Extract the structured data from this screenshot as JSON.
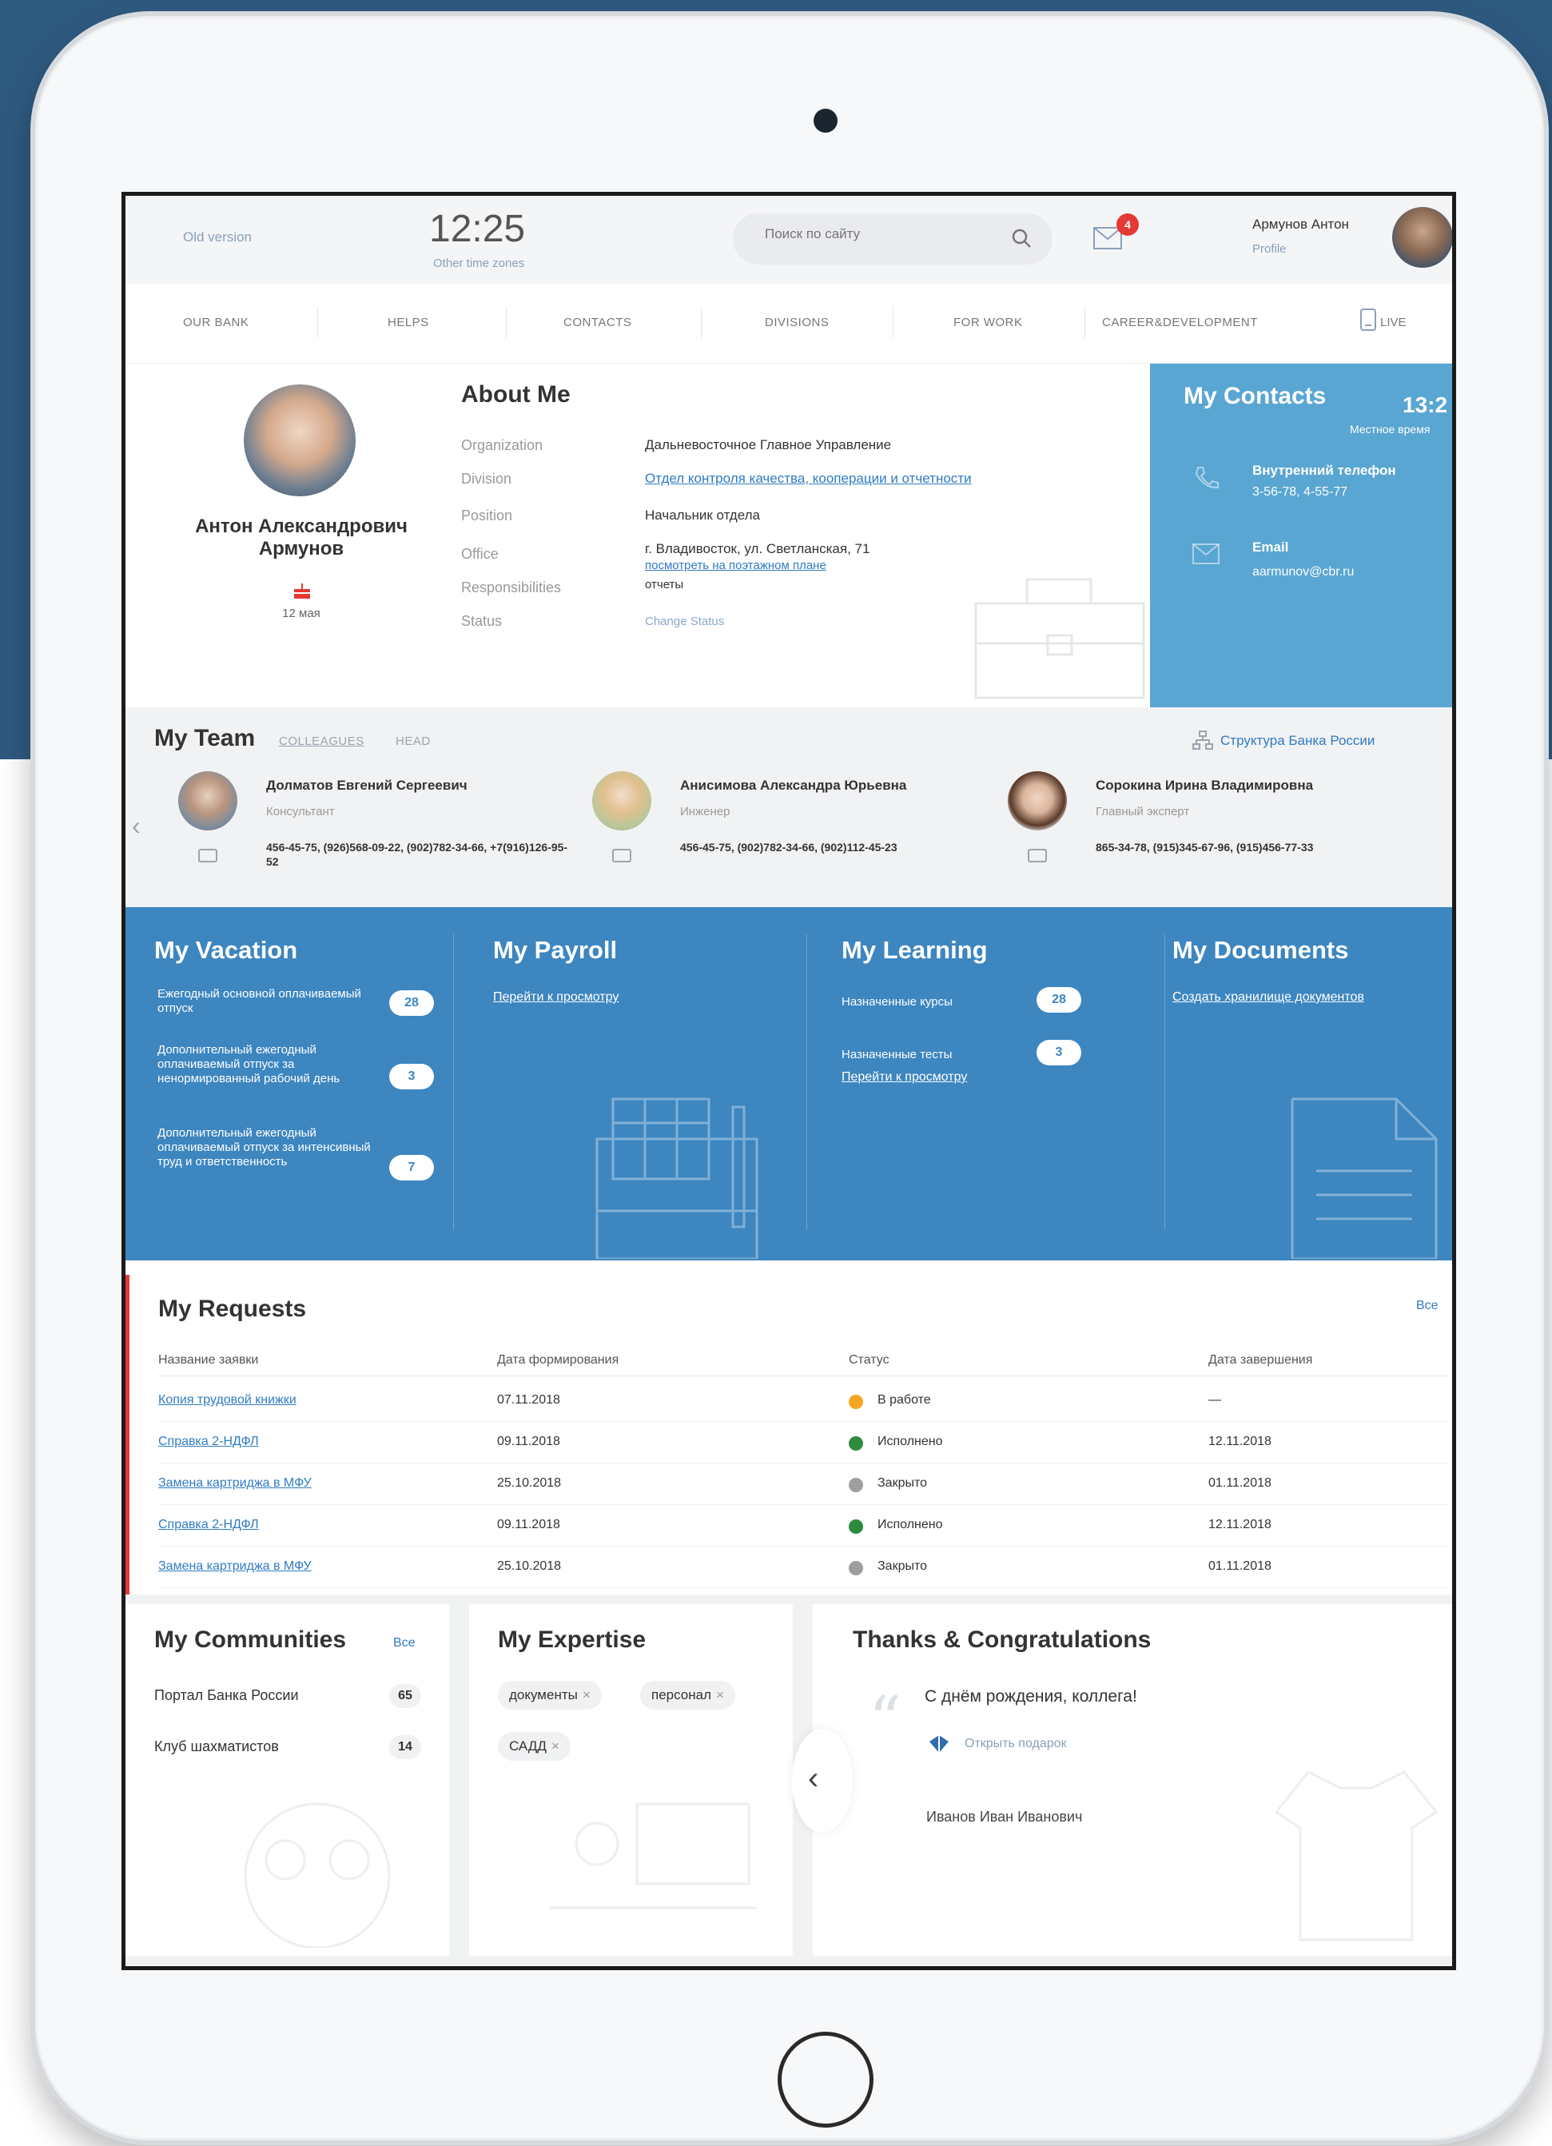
{
  "header": {
    "old_version": "Old version",
    "time": "12:25",
    "other_time": "Other time zones",
    "search_placeholder": "Поиск по сайту",
    "mail_badge": "4",
    "user_name": "Армунов Антон",
    "profile": "Profile"
  },
  "nav": {
    "items": [
      "OUR BANK",
      "HELPS",
      "CONTACTS",
      "DIVISIONS",
      "FOR WORK",
      "CAREER&DEVELOPMENT"
    ],
    "live": "LIVE"
  },
  "about": {
    "name": "Антон Александрович Армунов",
    "birthday": "12 мая",
    "title": "About Me",
    "labels": [
      "Organization",
      "Division",
      "Position",
      "Office",
      "Responsibilities",
      "Status"
    ],
    "organization": "Дальневосточное Главное Управление",
    "division": "Отдел контроля качества, кооперации и отчетности",
    "position": "Начальник отдела",
    "office": "г. Владивосток, ул. Светланская, 71",
    "office_link": "посмотреть на поэтажном плане",
    "responsibilities": "отчеты",
    "status_link": "Change Status"
  },
  "contacts": {
    "title": "My Contacts",
    "time": "13:2",
    "local_time": "Местное время",
    "phone_label": "Внутренний телефон",
    "phone_value": "3-56-78, 4-55-77",
    "email_label": "Email",
    "email_value": "aarmunov@cbr.ru"
  },
  "team": {
    "title": "My Team",
    "tabs": [
      "COLLEAGUES",
      "HEAD"
    ],
    "structure_link": "Структура Банка России",
    "members": [
      {
        "name": "Долматов Евгений Сергеевич",
        "role": "Консультант",
        "phones": "456-45-75, (926)568-09-22, (902)782-34-66, +7(916)126-95-52"
      },
      {
        "name": "Анисимова Александра Юрьевна",
        "role": "Инженер",
        "phones": "456-45-75, (902)782-34-66, (902)112-45-23"
      },
      {
        "name": "Сорокина Ирина Владимировна",
        "role": "Главный эксперт",
        "phones": "865-34-78, (915)345-67-96, (915)456-77-33"
      }
    ]
  },
  "vacation": {
    "title": "My Vacation",
    "items": [
      {
        "label": "Ежегодный основной оплачиваемый отпуск",
        "value": "28"
      },
      {
        "label": "Дополнительный ежегодный оплачиваемый отпуск за ненормированный рабочий день",
        "value": "3"
      },
      {
        "label": "Дополнительный ежегодный оплачиваемый отпуск за интенсивный труд и ответственность",
        "value": "7"
      }
    ]
  },
  "payroll": {
    "title": "My Payroll",
    "link": "Перейти к просмотру"
  },
  "learning": {
    "title": "My Learning",
    "courses_label": "Назначенные курсы",
    "courses_value": "28",
    "tests_label": "Назначенные тесты",
    "tests_value": "3",
    "link": "Перейти к просмотру"
  },
  "documents": {
    "title": "My Documents",
    "link": "Создать хранилище документов"
  },
  "requests": {
    "title": "My Requests",
    "all": "Все",
    "columns": [
      "Название заявки",
      "Дата формирования",
      "Статус",
      "Дата завершения"
    ],
    "status_colors": {
      "progress": "#f5a623",
      "done": "#2e8b3e",
      "closed": "#9e9e9e"
    },
    "rows": [
      {
        "name": "Копия трудовой книжки",
        "created": "07.11.2018",
        "status": "В работе",
        "status_key": "progress",
        "finished": "—"
      },
      {
        "name": "Справка 2-НДФЛ",
        "created": "09.11.2018",
        "status": "Исполнено",
        "status_key": "done",
        "finished": "12.11.2018"
      },
      {
        "name": "Замена картриджа в МФУ",
        "created": "25.10.2018",
        "status": "Закрыто",
        "status_key": "closed",
        "finished": "01.11.2018"
      },
      {
        "name": "Справка 2-НДФЛ",
        "created": "09.11.2018",
        "status": "Исполнено",
        "status_key": "done",
        "finished": "12.11.2018"
      },
      {
        "name": "Замена картриджа в МФУ",
        "created": "25.10.2018",
        "status": "Закрыто",
        "status_key": "closed",
        "finished": "01.11.2018"
      }
    ]
  },
  "communities": {
    "title": "My Communities",
    "all": "Все",
    "items": [
      {
        "name": "Портал Банка России",
        "count": "65"
      },
      {
        "name": "Клуб шахматистов",
        "count": "14"
      }
    ]
  },
  "expertise": {
    "title": "My Expertise",
    "tags": [
      "документы",
      "персонал",
      "САДД"
    ]
  },
  "congrats": {
    "title": "Thanks & Congratulations",
    "text": "С днём рождения, коллега!",
    "gift_link": "Открыть подарок",
    "author": "Иванов Иван Иванович"
  }
}
